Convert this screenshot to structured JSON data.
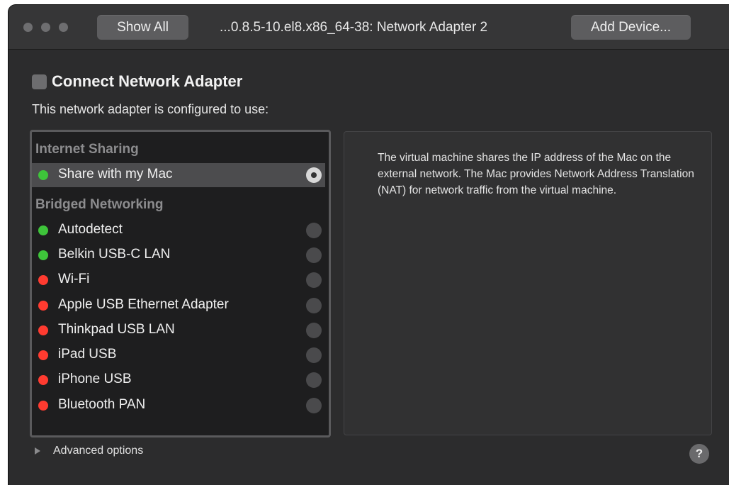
{
  "window": {
    "title": "...0.8.5-10.el8.x86_64-38: Network Adapter 2",
    "show_all_label": "Show All",
    "add_device_label": "Add Device..."
  },
  "connect": {
    "label": "Connect Network Adapter",
    "checked": false
  },
  "configured_text": "This network adapter is configured to use:",
  "list": {
    "groups": [
      {
        "header": "Internet Sharing",
        "items": [
          {
            "label": "Share with my Mac",
            "status": "green",
            "selected": true
          }
        ]
      },
      {
        "header": "Bridged Networking",
        "items": [
          {
            "label": "Autodetect",
            "status": "green",
            "selected": false
          },
          {
            "label": "Belkin USB-C LAN",
            "status": "green",
            "selected": false
          },
          {
            "label": "Wi-Fi",
            "status": "red",
            "selected": false
          },
          {
            "label": "Apple USB Ethernet Adapter",
            "status": "red",
            "selected": false
          },
          {
            "label": "Thinkpad USB LAN",
            "status": "red",
            "selected": false
          },
          {
            "label": "iPad USB",
            "status": "red",
            "selected": false
          },
          {
            "label": "iPhone USB",
            "status": "red",
            "selected": false
          },
          {
            "label": "Bluetooth PAN",
            "status": "red",
            "selected": false
          }
        ]
      }
    ]
  },
  "description": "The virtual machine shares the IP address of the Mac on the external network. The Mac provides Network Address Translation (NAT) for network traffic from the virtual machine.",
  "advanced_label": "Advanced options",
  "help_label": "?",
  "colors": {
    "status_green": "#3ec43a",
    "status_red": "#ff3b30"
  }
}
